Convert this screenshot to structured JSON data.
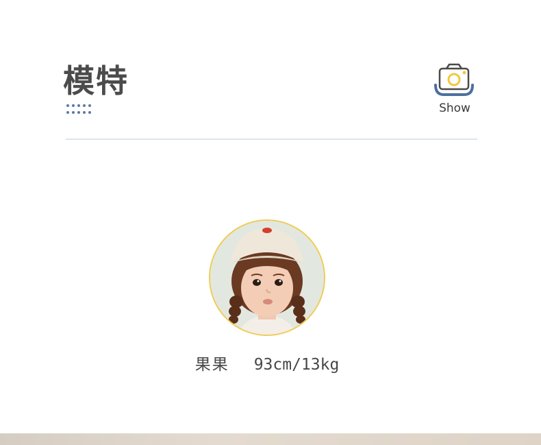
{
  "header": {
    "title": "模特",
    "show_label": "Show",
    "icon": "camera-icon",
    "accent_blue": "#4d6f9f",
    "accent_yellow": "#f2c83c"
  },
  "model": {
    "name": "果果",
    "measurements": "93cm/13kg",
    "photo": "child-portrait",
    "frame_color": "#f0cc56"
  }
}
